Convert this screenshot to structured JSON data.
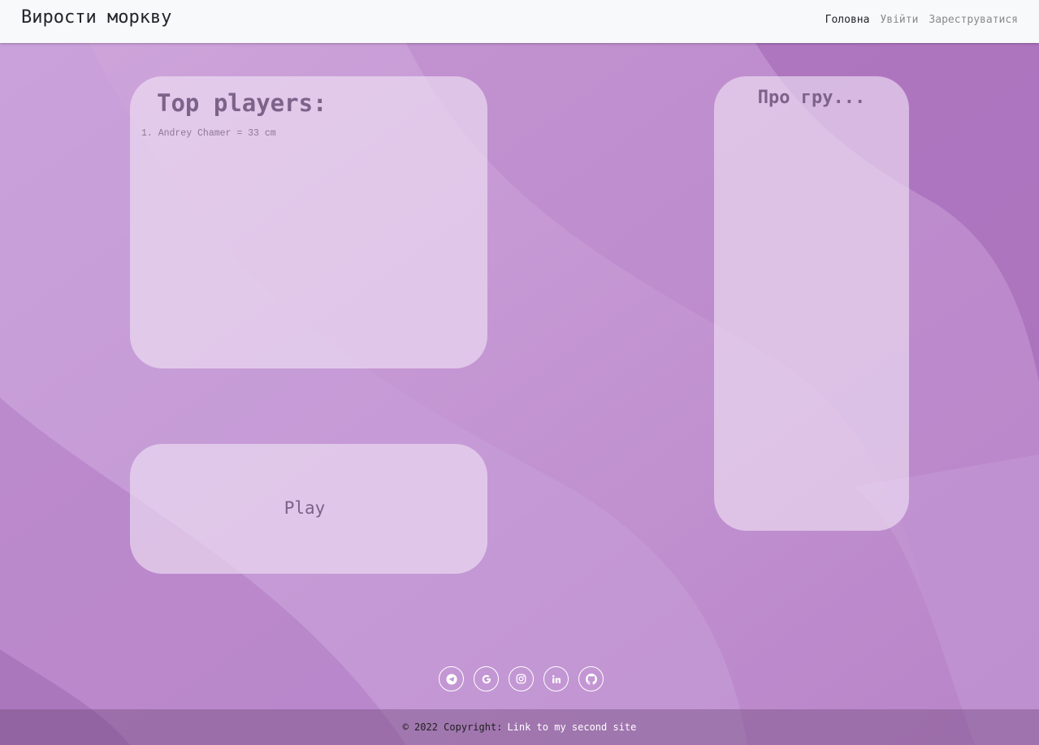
{
  "navbar": {
    "brand": "Вирости моркву",
    "links": [
      {
        "label": "Головна",
        "active": true
      },
      {
        "label": "Увійти",
        "active": false
      },
      {
        "label": "Зареструватися",
        "active": false
      }
    ]
  },
  "top_players": {
    "title": "Top players:",
    "entries": [
      {
        "text": "1. Andrey Chamer = 33 cm"
      }
    ]
  },
  "play": {
    "label": "Play"
  },
  "about": {
    "title": "Про гру..."
  },
  "social": [
    {
      "icon": "telegram-icon"
    },
    {
      "icon": "google-icon"
    },
    {
      "icon": "instagram-icon"
    },
    {
      "icon": "linkedin-icon"
    },
    {
      "icon": "github-icon"
    }
  ],
  "footer": {
    "copyright": "© 2022 Copyright:",
    "link_label": "Link to my second site"
  },
  "colors": {
    "background": "#c39ad3",
    "navbar": "#f8f9fa",
    "card_text": "#7d6289"
  }
}
